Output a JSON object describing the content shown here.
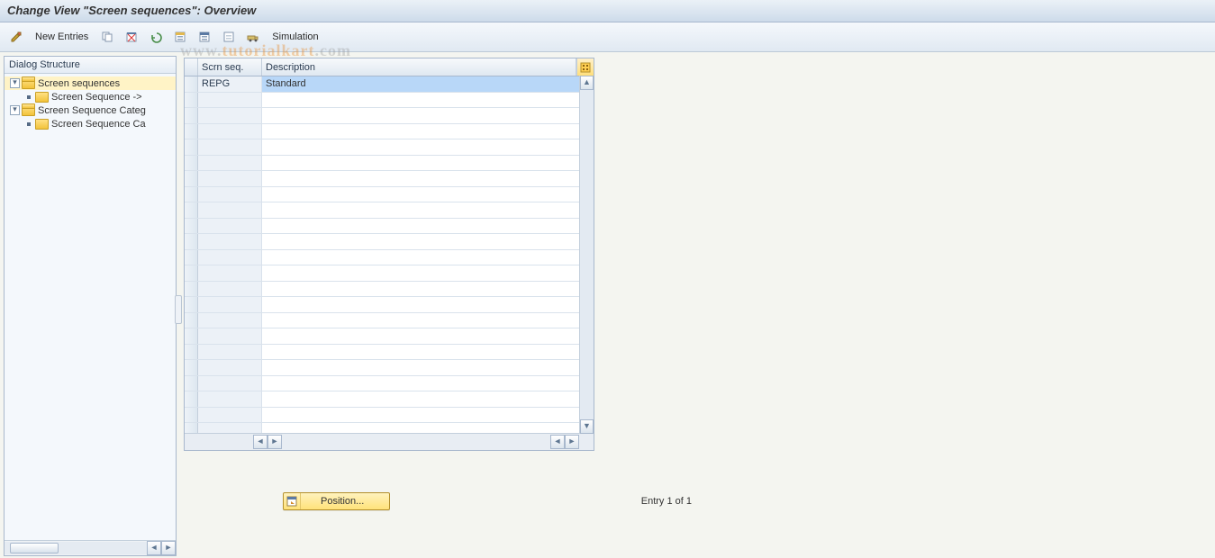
{
  "title": "Change View \"Screen sequences\": Overview",
  "toolbar": {
    "new_entries": "New Entries",
    "simulation": "Simulation"
  },
  "dialog_structure": {
    "header": "Dialog Structure",
    "nodes": [
      {
        "label": "Screen sequences",
        "open": true,
        "level": 0,
        "exp": true,
        "sel": true
      },
      {
        "label": "Screen Sequence -> ",
        "open": false,
        "level": 1,
        "exp": false,
        "bullet": true
      },
      {
        "label": "Screen Sequence Categ",
        "open": true,
        "level": 0,
        "exp": true
      },
      {
        "label": "Screen Sequence Ca",
        "open": false,
        "level": 1,
        "exp": false,
        "bullet": true
      }
    ]
  },
  "table": {
    "col_scrn": "Scrn seq.",
    "col_desc": "Description",
    "rows": [
      {
        "scrn": "REPG",
        "desc": "Standard",
        "sel": true
      }
    ],
    "blank_rows": 23
  },
  "footer": {
    "position_btn": "Position...",
    "entry_text": "Entry 1 of 1"
  },
  "watermark_a": "www.",
  "watermark_b": "tutorialkart",
  "watermark_c": ".com"
}
